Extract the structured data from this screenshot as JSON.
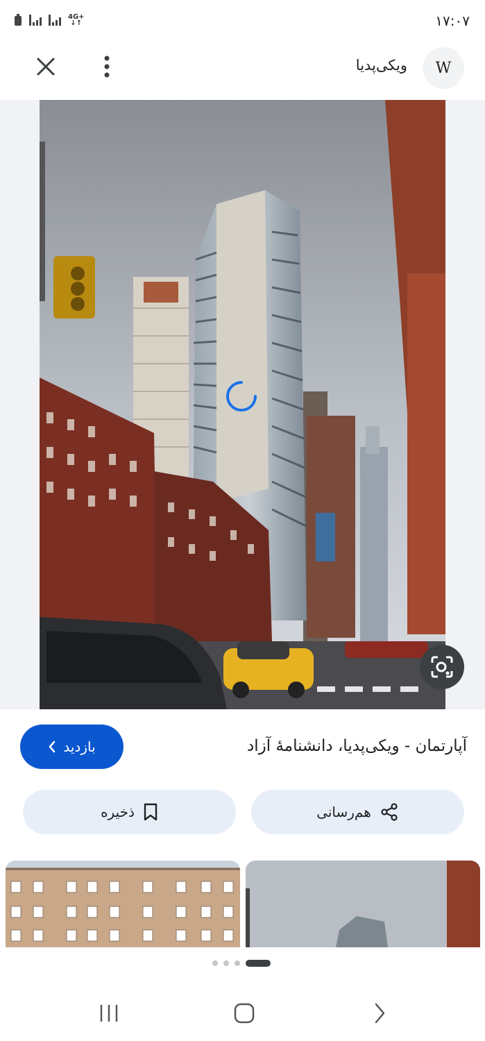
{
  "status_bar": {
    "time": "۱۷:۰۷",
    "network": "4G+"
  },
  "header": {
    "source_name": "ویکی‌پدیا",
    "logo_letter": "W"
  },
  "image": {
    "title": "آپارتمان - ویکی‌پدیا، دانشنامهٔ آزاد",
    "visit_label": "بازدید",
    "share_label": "هم‌رسانی",
    "save_label": "ذخیره"
  },
  "pager": {
    "count": 4,
    "active_index": 3
  },
  "colors": {
    "accent": "#0b57d0",
    "pill_background": "#e8eef7",
    "lens_button": "#3c4043"
  },
  "icons": {
    "close": "close-icon",
    "more": "more-vert-icon",
    "lens": "lens-icon",
    "chevron": "chevron-left-icon",
    "share": "share-icon",
    "bookmark": "bookmark-icon",
    "recents": "recents-icon",
    "home": "home-icon",
    "back": "back-icon"
  }
}
